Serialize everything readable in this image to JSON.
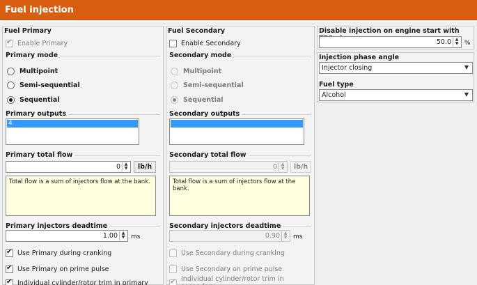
{
  "window": {
    "title": "Fuel injection"
  },
  "primary": {
    "title": "Fuel Primary",
    "enable_label": "Enable Primary",
    "enable_checked": true,
    "mode_label": "Primary mode",
    "modes": [
      "Multipoint",
      "Semi-sequential",
      "Sequential"
    ],
    "selected_mode": "Sequential",
    "outputs_label": "Primary outputs",
    "outputs_items": [
      "4"
    ],
    "total_flow_label": "Primary total flow",
    "total_flow_value": "0",
    "total_flow_unit": "lb/h",
    "note": "Total flow is a sum of injectors flow at the bank.",
    "deadtime_label": "Primary injectors deadtime",
    "deadtime_value": "1.00",
    "deadtime_unit": "ms",
    "options": [
      {
        "label": "Use Primary during cranking",
        "checked": true
      },
      {
        "label": "Use Primary on prime pulse",
        "checked": true
      },
      {
        "label": "Individual cylinder/rotor trim in primary",
        "checked": true
      }
    ]
  },
  "secondary": {
    "title": "Fuel Secondary",
    "enable_label": "Enable Secondary",
    "enable_checked": false,
    "mode_label": "Secondary mode",
    "modes": [
      "Multipoint",
      "Semi-sequential",
      "Sequential"
    ],
    "selected_mode": "Sequential",
    "outputs_label": "Secondary outputs",
    "outputs_items": [
      ""
    ],
    "total_flow_label": "Secondary total flow",
    "total_flow_value": "0",
    "total_flow_unit": "lb/h",
    "note": "Total flow is a sum of injectors flow at the bank.",
    "deadtime_label": "Secondary injectors deadtime",
    "deadtime_value": "0.90",
    "deadtime_unit": "ms",
    "options": [
      {
        "label": "Use Secondary during cranking",
        "checked": false
      },
      {
        "label": "Use Secondary on prime pulse",
        "checked": false
      },
      {
        "label": "Individual cylinder/rotor trim in secondary",
        "checked": true
      }
    ]
  },
  "right": {
    "disable_label": "Disable injection on engine start with TPS above",
    "disable_value": "50.0",
    "disable_unit": "%",
    "phase_label": "Injection phase angle",
    "phase_value": "Injector closing",
    "fueltype_label": "Fuel type",
    "fueltype_value": "Alcohol"
  },
  "colors": {
    "title_bar": "#d95e10",
    "selection": "#3399ff",
    "note_bg": "#ffffe0"
  }
}
